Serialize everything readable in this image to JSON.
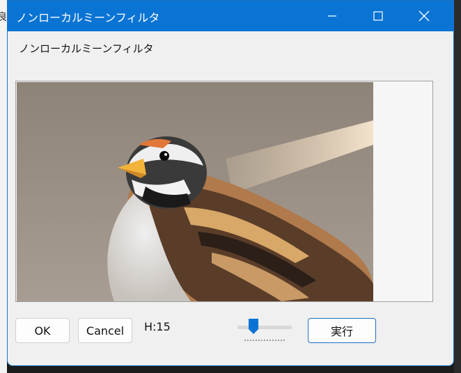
{
  "background": {
    "left_char": "良"
  },
  "window": {
    "title": "ノンローカルミーンフィルタ",
    "label": "ノンローカルミーンフィルタ",
    "accent_color": "#0a74d4"
  },
  "titlebar_buttons": {
    "minimize": "minimize-icon",
    "maximize": "maximize-icon",
    "close": "close-icon"
  },
  "preview": {
    "icon": "sparrow-photo"
  },
  "controls": {
    "ok_label": "OK",
    "cancel_label": "Cancel",
    "h_label": "H:15",
    "run_label": "実行",
    "h_slider_fraction": 0.3
  }
}
